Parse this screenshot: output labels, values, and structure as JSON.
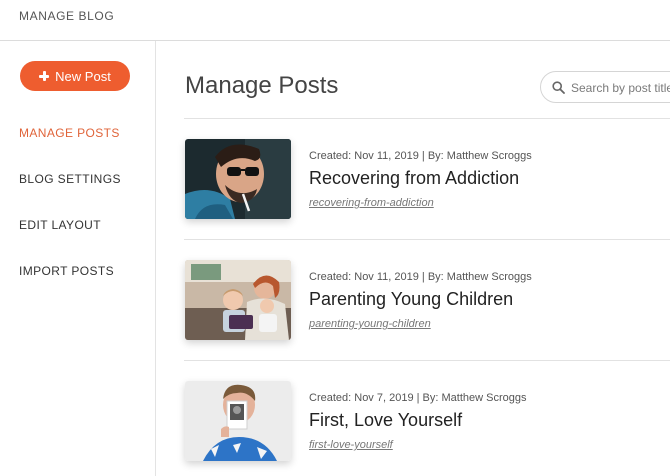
{
  "app": {
    "title": "MANAGE BLOG"
  },
  "sidebar": {
    "new_post_label": "New Post",
    "items": [
      {
        "label": "MANAGE POSTS",
        "active": true
      },
      {
        "label": "BLOG SETTINGS",
        "active": false
      },
      {
        "label": "EDIT LAYOUT",
        "active": false
      },
      {
        "label": "IMPORT POSTS",
        "active": false
      }
    ]
  },
  "main": {
    "title": "Manage Posts",
    "search": {
      "placeholder": "Search by post title",
      "value": ""
    },
    "posts": [
      {
        "meta": "Created: Nov 11, 2019 | By: Matthew Scroggs",
        "title": "Recovering from Addiction",
        "slug": "recovering-from-addiction",
        "image": "man-with-sunglasses-photo"
      },
      {
        "meta": "Created: Nov 11, 2019 | By: Matthew Scroggs",
        "title": "Parenting Young Children",
        "slug": "parenting-young-children",
        "image": "mother-with-children-photo"
      },
      {
        "meta": "Created: Nov 7, 2019 | By: Matthew Scroggs",
        "title": "First, Love Yourself",
        "slug": "first-love-yourself",
        "image": "man-holding-photo"
      }
    ]
  },
  "colors": {
    "accent": "#ee5d2f",
    "active_nav": "#e0643a",
    "divider": "#e2e2e2"
  }
}
